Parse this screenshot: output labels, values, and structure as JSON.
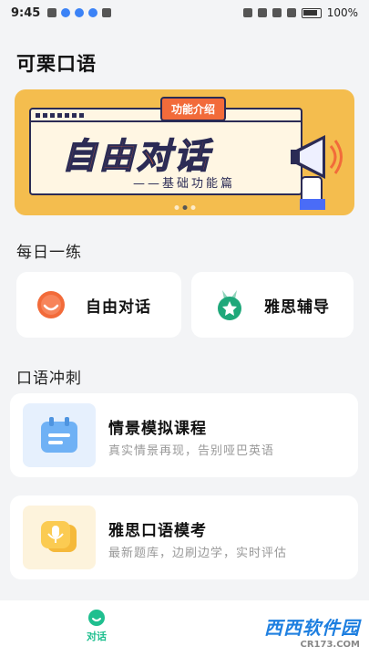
{
  "status": {
    "time": "9:45",
    "battery": "100%"
  },
  "app": {
    "title": "可栗口语"
  },
  "banner": {
    "tag": "功能介绍",
    "headline": "自由对话",
    "subtitle": "——基础功能篇",
    "slides": 3,
    "active_slide": 2
  },
  "daily": {
    "title": "每日一练",
    "items": [
      {
        "label": "自由对话",
        "icon": "smile-face-icon"
      },
      {
        "label": "雅思辅导",
        "icon": "star-medal-icon"
      }
    ]
  },
  "sprint": {
    "title": "口语冲刺",
    "courses": [
      {
        "title": "情景模拟课程",
        "desc": "真实情景再现，告别哑巴英语",
        "icon": "calendar-icon"
      },
      {
        "title": "雅思口语模考",
        "desc": "最新题库，边刷边学，实时评估",
        "icon": "microphone-chat-icon"
      }
    ]
  },
  "tabbar": {
    "items": [
      {
        "label": "对话",
        "active": true
      }
    ]
  },
  "watermark": {
    "brand": "西西软件园",
    "site": "CR173.COM"
  },
  "colors": {
    "accent": "#1fbf8f",
    "orange": "#f26b3a",
    "banner_bg": "#f4bd4e"
  }
}
